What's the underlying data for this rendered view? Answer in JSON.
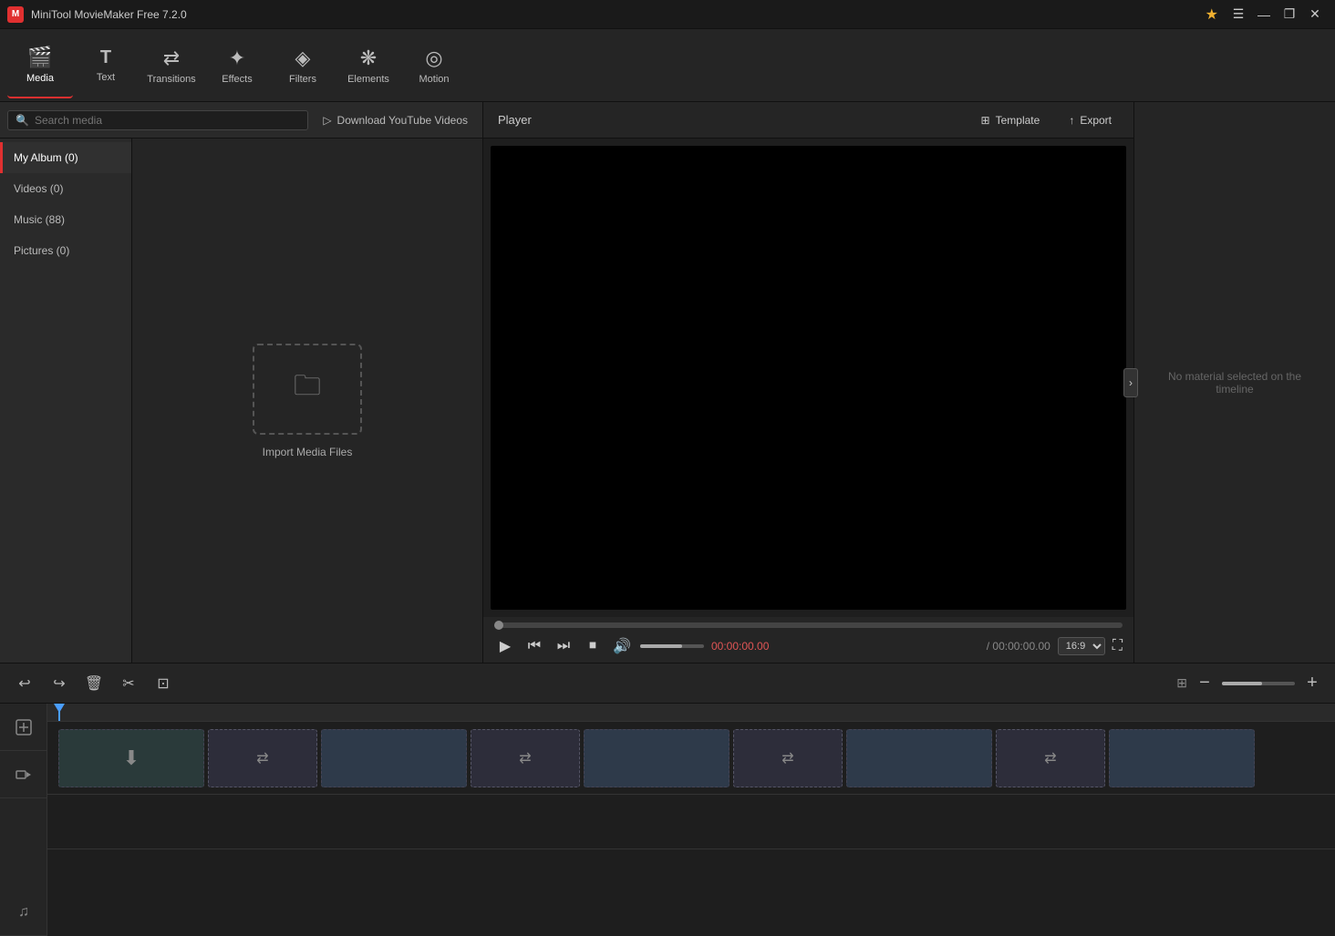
{
  "app": {
    "title": "MiniTool MovieMaker Free 7.2.0",
    "logo": "M"
  },
  "titlebar": {
    "controls": {
      "star_icon": "★",
      "menu_icon": "☰",
      "minimize": "—",
      "restore": "❐",
      "close": "✕"
    }
  },
  "toolbar": {
    "items": [
      {
        "id": "media",
        "label": "Media",
        "icon": "▦",
        "active": true
      },
      {
        "id": "text",
        "label": "Text",
        "icon": "T"
      },
      {
        "id": "transitions",
        "label": "Transitions",
        "icon": "⇄"
      },
      {
        "id": "effects",
        "label": "Effects",
        "icon": "✦"
      },
      {
        "id": "filters",
        "label": "Filters",
        "icon": "◈"
      },
      {
        "id": "elements",
        "label": "Elements",
        "icon": "❋"
      },
      {
        "id": "motion",
        "label": "Motion",
        "icon": "◎"
      }
    ]
  },
  "media_toolbar": {
    "search_placeholder": "Search media",
    "download_label": "Download YouTube Videos",
    "download_icon": "▷"
  },
  "sidebar": {
    "items": [
      {
        "label": "My Album (0)",
        "active": true
      },
      {
        "label": "Videos (0)",
        "active": false
      },
      {
        "label": "Music (88)",
        "active": false
      },
      {
        "label": "Pictures (0)",
        "active": false
      }
    ]
  },
  "import": {
    "label": "Import Media Files",
    "folder_icon": "🗀"
  },
  "player": {
    "title": "Player",
    "template_label": "Template",
    "export_label": "Export",
    "current_time": "00:00:00.00",
    "total_time": "/ 00:00:00.00",
    "aspect_ratio": "16:9"
  },
  "properties": {
    "empty_label": "No material selected on the timeline"
  },
  "timeline": {
    "tools": {
      "undo": "↩",
      "redo": "↪",
      "delete": "🗑",
      "cut": "✂",
      "crop": "⊡"
    },
    "zoom": {
      "minus": "—",
      "plus": "+"
    },
    "side_icons": {
      "add": "+",
      "video_track": "▬",
      "audio_track": "♫"
    }
  },
  "colors": {
    "accent": "#e03030",
    "accent_blue": "#4a9eff",
    "bg_dark": "#1e1e1e",
    "bg_medium": "#252525",
    "text_muted": "#888888",
    "time_red": "#e05555"
  }
}
